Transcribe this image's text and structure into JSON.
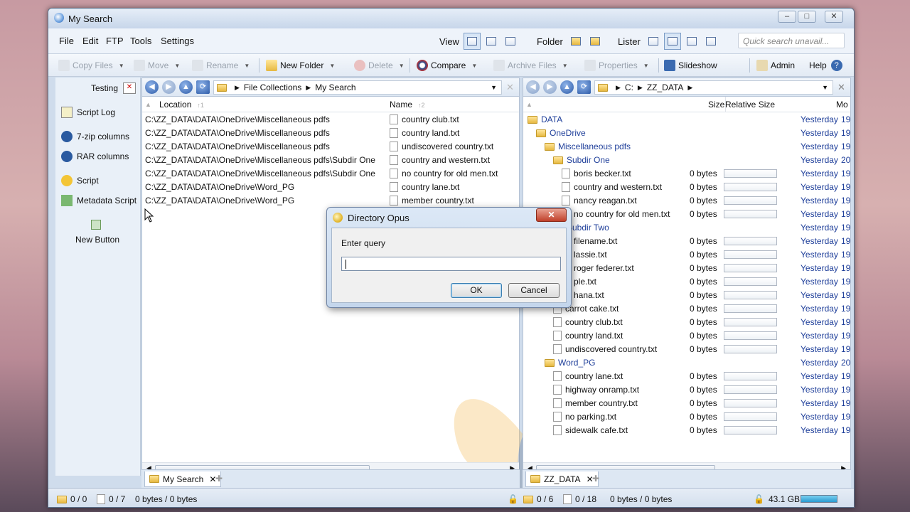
{
  "window": {
    "title": "My Search"
  },
  "menu": [
    "File",
    "Edit",
    "FTP",
    "Tools",
    "Settings"
  ],
  "views": {
    "view": "View",
    "folder": "Folder",
    "lister": "Lister"
  },
  "search": {
    "placeholder": "Quick search unavail..."
  },
  "toolbar": {
    "copy": "Copy Files",
    "move": "Move",
    "rename": "Rename",
    "new_folder": "New Folder",
    "delete": "Delete",
    "compare": "Compare",
    "archive": "Archive Files",
    "properties": "Properties",
    "slideshow": "Slideshow",
    "admin": "Admin",
    "help": "Help"
  },
  "sidebar": {
    "title": "Testing",
    "items": [
      "Script Log",
      "7-zip columns",
      "RAR columns",
      "Script",
      "Metadata Script",
      "New Button"
    ]
  },
  "left": {
    "path": [
      "File Collections",
      "My Search"
    ],
    "cols": {
      "location": "Location",
      "location_sort": "↑1",
      "name": "Name",
      "name_sort": "↑2"
    },
    "rows": [
      {
        "loc": "C:\\ZZ_DATA\\DATA\\OneDrive\\Miscellaneous pdfs",
        "name": "country club.txt"
      },
      {
        "loc": "C:\\ZZ_DATA\\DATA\\OneDrive\\Miscellaneous pdfs",
        "name": "country land.txt"
      },
      {
        "loc": "C:\\ZZ_DATA\\DATA\\OneDrive\\Miscellaneous pdfs",
        "name": "undiscovered country.txt"
      },
      {
        "loc": "C:\\ZZ_DATA\\DATA\\OneDrive\\Miscellaneous pdfs\\Subdir One",
        "name": "country and western.txt"
      },
      {
        "loc": "C:\\ZZ_DATA\\DATA\\OneDrive\\Miscellaneous pdfs\\Subdir One",
        "name": "no country for old men.txt"
      },
      {
        "loc": "C:\\ZZ_DATA\\DATA\\OneDrive\\Word_PG",
        "name": "country lane.txt"
      },
      {
        "loc": "C:\\ZZ_DATA\\DATA\\OneDrive\\Word_PG",
        "name": "member country.txt"
      }
    ],
    "tab": "My Search"
  },
  "right": {
    "path": [
      "C:",
      "ZZ_DATA"
    ],
    "cols": {
      "size": "Size",
      "rel": "Relative Size",
      "mod": "Mo"
    },
    "rows": [
      {
        "name": "DATA",
        "indent": 0,
        "folder": true,
        "size": "",
        "date": "Yesterday",
        "time": "19"
      },
      {
        "name": "OneDrive",
        "indent": 1,
        "folder": true,
        "size": "",
        "date": "Yesterday",
        "time": "19"
      },
      {
        "name": "Miscellaneous pdfs",
        "indent": 2,
        "folder": true,
        "size": "",
        "date": "Yesterday",
        "time": "19"
      },
      {
        "name": "Subdir One",
        "indent": 3,
        "folder": true,
        "size": "",
        "date": "Yesterday",
        "time": "20"
      },
      {
        "name": "boris becker.txt",
        "indent": 4,
        "folder": false,
        "size": "0 bytes",
        "date": "Yesterday",
        "time": "19"
      },
      {
        "name": "country and western.txt",
        "indent": 4,
        "folder": false,
        "size": "0 bytes",
        "date": "Yesterday",
        "time": "19"
      },
      {
        "name": "nancy reagan.txt",
        "indent": 4,
        "folder": false,
        "size": "0 bytes",
        "date": "Yesterday",
        "time": "19"
      },
      {
        "name": "no country for old men.txt",
        "indent": 4,
        "folder": false,
        "size": "0 bytes",
        "date": "Yesterday",
        "time": "19"
      },
      {
        "name": "Subdir Two",
        "indent": 3,
        "folder": true,
        "size": "",
        "date": "Yesterday",
        "time": "19"
      },
      {
        "name": "filename.txt",
        "indent": 4,
        "folder": false,
        "size": "0 bytes",
        "date": "Yesterday",
        "time": "19"
      },
      {
        "name": "lassie.txt",
        "indent": 4,
        "folder": false,
        "size": "0 bytes",
        "date": "Yesterday",
        "time": "19"
      },
      {
        "name": "roger federer.txt",
        "indent": 4,
        "folder": false,
        "size": "0 bytes",
        "date": "Yesterday",
        "time": "19"
      },
      {
        "name": "ple.txt",
        "indent": 4,
        "folder": false,
        "size": "0 bytes",
        "date": "Yesterday",
        "time": "19"
      },
      {
        "name": "hana.txt",
        "indent": 4,
        "folder": false,
        "size": "0 bytes",
        "date": "Yesterday",
        "time": "19"
      },
      {
        "name": "carrot cake.txt",
        "indent": 3,
        "folder": false,
        "size": "0 bytes",
        "date": "Yesterday",
        "time": "19"
      },
      {
        "name": "country club.txt",
        "indent": 3,
        "folder": false,
        "size": "0 bytes",
        "date": "Yesterday",
        "time": "19"
      },
      {
        "name": "country land.txt",
        "indent": 3,
        "folder": false,
        "size": "0 bytes",
        "date": "Yesterday",
        "time": "19"
      },
      {
        "name": "undiscovered country.txt",
        "indent": 3,
        "folder": false,
        "size": "0 bytes",
        "date": "Yesterday",
        "time": "19"
      },
      {
        "name": "Word_PG",
        "indent": 2,
        "folder": true,
        "size": "",
        "date": "Yesterday",
        "time": "20"
      },
      {
        "name": "country lane.txt",
        "indent": 3,
        "folder": false,
        "size": "0 bytes",
        "date": "Yesterday",
        "time": "19"
      },
      {
        "name": "highway onramp.txt",
        "indent": 3,
        "folder": false,
        "size": "0 bytes",
        "date": "Yesterday",
        "time": "19"
      },
      {
        "name": "member country.txt",
        "indent": 3,
        "folder": false,
        "size": "0 bytes",
        "date": "Yesterday",
        "time": "19"
      },
      {
        "name": "no parking.txt",
        "indent": 3,
        "folder": false,
        "size": "0 bytes",
        "date": "Yesterday",
        "time": "19"
      },
      {
        "name": "sidewalk cafe.txt",
        "indent": 3,
        "folder": false,
        "size": "0 bytes",
        "date": "Yesterday",
        "time": "19"
      }
    ],
    "tab": "ZZ_DATA"
  },
  "status": {
    "l_folders": "0 / 0",
    "l_files": "0 / 7",
    "l_bytes": "0 bytes / 0 bytes",
    "r_folders": "0 / 6",
    "r_files": "0 / 18",
    "r_bytes": "0 bytes / 0 bytes",
    "free": "43.1 GB"
  },
  "dialog": {
    "title": "Directory Opus",
    "prompt": "Enter query",
    "value": "",
    "ok": "OK",
    "cancel": "Cancel"
  }
}
